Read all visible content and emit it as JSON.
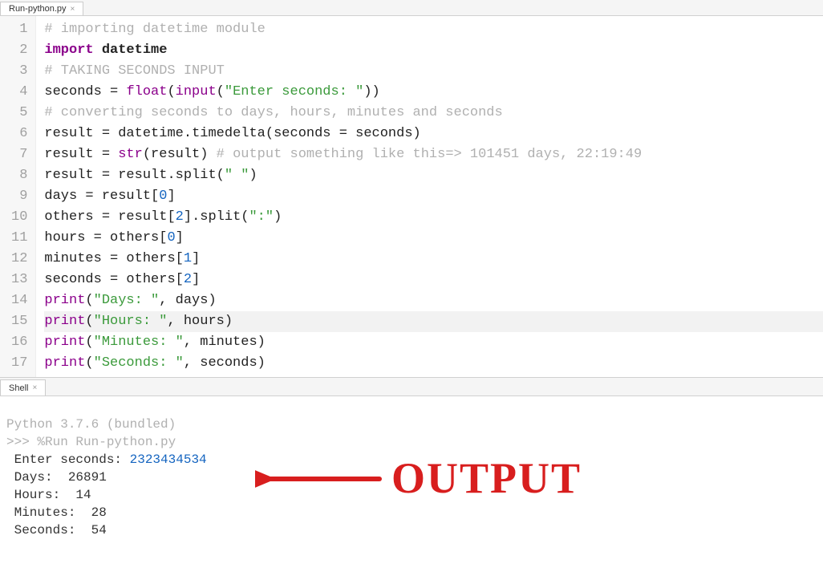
{
  "editor_tab": {
    "name": "Run-python.py"
  },
  "shell_tab": {
    "name": "Shell"
  },
  "code": {
    "lines": [
      {
        "n": "1",
        "tokens": [
          {
            "t": "# importing datetime module",
            "c": "cm"
          }
        ]
      },
      {
        "n": "2",
        "tokens": [
          {
            "t": "import",
            "c": "kw"
          },
          {
            "t": " ",
            "c": "op"
          },
          {
            "t": "datetime",
            "c": "pn"
          }
        ]
      },
      {
        "n": "3",
        "tokens": [
          {
            "t": "# TAKING SECONDS INPUT",
            "c": "cm"
          }
        ]
      },
      {
        "n": "4",
        "tokens": [
          {
            "t": "seconds ",
            "c": "id"
          },
          {
            "t": "=",
            "c": "op"
          },
          {
            "t": " ",
            "c": "op"
          },
          {
            "t": "float",
            "c": "bi"
          },
          {
            "t": "(",
            "c": "op"
          },
          {
            "t": "input",
            "c": "bi"
          },
          {
            "t": "(",
            "c": "op"
          },
          {
            "t": "\"Enter seconds: \"",
            "c": "str"
          },
          {
            "t": "))",
            "c": "op"
          }
        ]
      },
      {
        "n": "5",
        "tokens": [
          {
            "t": "# converting seconds to days, hours, minutes and seconds",
            "c": "cm"
          }
        ]
      },
      {
        "n": "6",
        "tokens": [
          {
            "t": "result ",
            "c": "id"
          },
          {
            "t": "=",
            "c": "op"
          },
          {
            "t": " datetime",
            "c": "id"
          },
          {
            "t": ".",
            "c": "op"
          },
          {
            "t": "timedelta",
            "c": "id"
          },
          {
            "t": "(",
            "c": "op"
          },
          {
            "t": "seconds ",
            "c": "id"
          },
          {
            "t": "=",
            "c": "op"
          },
          {
            "t": " seconds",
            "c": "id"
          },
          {
            "t": ")",
            "c": "op"
          }
        ]
      },
      {
        "n": "7",
        "tokens": [
          {
            "t": "result ",
            "c": "id"
          },
          {
            "t": "=",
            "c": "op"
          },
          {
            "t": " ",
            "c": "op"
          },
          {
            "t": "str",
            "c": "bi"
          },
          {
            "t": "(result) ",
            "c": "id"
          },
          {
            "t": "# output something like this=> 101451 days, 22:19:49",
            "c": "cm"
          }
        ]
      },
      {
        "n": "8",
        "tokens": [
          {
            "t": "result ",
            "c": "id"
          },
          {
            "t": "=",
            "c": "op"
          },
          {
            "t": " result",
            "c": "id"
          },
          {
            "t": ".",
            "c": "op"
          },
          {
            "t": "split",
            "c": "id"
          },
          {
            "t": "(",
            "c": "op"
          },
          {
            "t": "\" \"",
            "c": "str"
          },
          {
            "t": ")",
            "c": "op"
          }
        ]
      },
      {
        "n": "9",
        "tokens": [
          {
            "t": "days ",
            "c": "id"
          },
          {
            "t": "=",
            "c": "op"
          },
          {
            "t": " result",
            "c": "id"
          },
          {
            "t": "[",
            "c": "op"
          },
          {
            "t": "0",
            "c": "num"
          },
          {
            "t": "]",
            "c": "op"
          }
        ]
      },
      {
        "n": "10",
        "tokens": [
          {
            "t": "others ",
            "c": "id"
          },
          {
            "t": "=",
            "c": "op"
          },
          {
            "t": " result",
            "c": "id"
          },
          {
            "t": "[",
            "c": "op"
          },
          {
            "t": "2",
            "c": "num"
          },
          {
            "t": "]",
            "c": "op"
          },
          {
            "t": ".",
            "c": "op"
          },
          {
            "t": "split",
            "c": "id"
          },
          {
            "t": "(",
            "c": "op"
          },
          {
            "t": "\":\"",
            "c": "str"
          },
          {
            "t": ")",
            "c": "op"
          }
        ]
      },
      {
        "n": "11",
        "tokens": [
          {
            "t": "hours ",
            "c": "id"
          },
          {
            "t": "=",
            "c": "op"
          },
          {
            "t": " others",
            "c": "id"
          },
          {
            "t": "[",
            "c": "op"
          },
          {
            "t": "0",
            "c": "num"
          },
          {
            "t": "]",
            "c": "op"
          }
        ]
      },
      {
        "n": "12",
        "tokens": [
          {
            "t": "minutes ",
            "c": "id"
          },
          {
            "t": "=",
            "c": "op"
          },
          {
            "t": " others",
            "c": "id"
          },
          {
            "t": "[",
            "c": "op"
          },
          {
            "t": "1",
            "c": "num"
          },
          {
            "t": "]",
            "c": "op"
          }
        ]
      },
      {
        "n": "13",
        "tokens": [
          {
            "t": "seconds ",
            "c": "id"
          },
          {
            "t": "=",
            "c": "op"
          },
          {
            "t": " others",
            "c": "id"
          },
          {
            "t": "[",
            "c": "op"
          },
          {
            "t": "2",
            "c": "num"
          },
          {
            "t": "]",
            "c": "op"
          }
        ]
      },
      {
        "n": "14",
        "tokens": [
          {
            "t": "print",
            "c": "bi"
          },
          {
            "t": "(",
            "c": "op"
          },
          {
            "t": "\"Days: \"",
            "c": "str"
          },
          {
            "t": ", days)",
            "c": "id"
          }
        ]
      },
      {
        "n": "15",
        "hl": true,
        "tokens": [
          {
            "t": "print",
            "c": "bi"
          },
          {
            "t": "(",
            "c": "op"
          },
          {
            "t": "\"Hours: \"",
            "c": "str"
          },
          {
            "t": ", hours)",
            "c": "id"
          }
        ]
      },
      {
        "n": "16",
        "tokens": [
          {
            "t": "print",
            "c": "bi"
          },
          {
            "t": "(",
            "c": "op"
          },
          {
            "t": "\"Minutes: \"",
            "c": "str"
          },
          {
            "t": ", minutes)",
            "c": "id"
          }
        ]
      },
      {
        "n": "17",
        "tokens": [
          {
            "t": "print",
            "c": "bi"
          },
          {
            "t": "(",
            "c": "op"
          },
          {
            "t": "\"Seconds: \"",
            "c": "str"
          },
          {
            "t": ", seconds)",
            "c": "id"
          }
        ]
      }
    ]
  },
  "shell": {
    "version": "Python 3.7.6 (bundled)",
    "prompt": ">>> ",
    "command": "%Run Run-python.py",
    "output": [
      {
        "label": " Enter seconds: ",
        "value": "2323434534",
        "value_class": "shell-input"
      },
      {
        "label": " Days:  ",
        "value": "26891",
        "value_class": "shell-val"
      },
      {
        "label": " Hours:  ",
        "value": "14",
        "value_class": "shell-val"
      },
      {
        "label": " Minutes:  ",
        "value": "28",
        "value_class": "shell-val"
      },
      {
        "label": " Seconds:  ",
        "value": "54",
        "value_class": "shell-val"
      }
    ]
  },
  "annotation": {
    "text": "OUTPUT",
    "color": "#d81e1e"
  }
}
